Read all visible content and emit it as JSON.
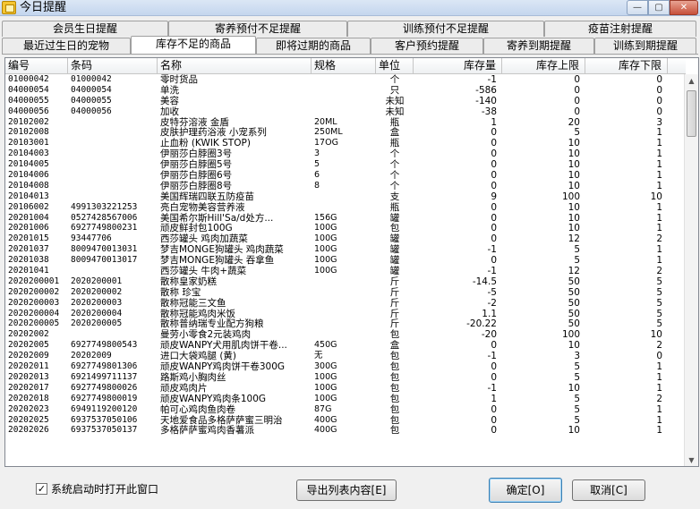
{
  "window": {
    "title": "今日提醒",
    "close_glyph": "✕",
    "min_glyph": "—",
    "max_glyph": "▢"
  },
  "tabs_top": [
    "会员生日提醒",
    "寄养预付不足提醒",
    "训练预付不足提醒",
    "疫苗注射提醒"
  ],
  "tabs_bottom": [
    "最近过生日的宠物",
    "库存不足的商品",
    "即将过期的商品",
    "客户预约提醒",
    "寄养到期提醒",
    "训练到期提醒"
  ],
  "active_tab": "库存不足的商品",
  "columns": [
    "编号",
    "条码",
    "名称",
    "规格",
    "单位",
    "库存量",
    "库存上限",
    "库存下限"
  ],
  "rows": [
    [
      "01000042",
      "01000042",
      "零时货品",
      "",
      "个",
      "-1",
      "0",
      "0"
    ],
    [
      "04000054",
      "04000054",
      "单洗",
      "",
      "只",
      "-586",
      "0",
      "0"
    ],
    [
      "04000055",
      "04000055",
      "美容",
      "",
      "未知",
      "-140",
      "0",
      "0"
    ],
    [
      "04000056",
      "04000056",
      "加收",
      "",
      "未知",
      "-38",
      "0",
      "0"
    ],
    [
      "20102002",
      "",
      "皮特芬溶液 金盾",
      "20ML",
      "瓶",
      "1",
      "20",
      "3"
    ],
    [
      "20102008",
      "",
      "皮肤护理药浴液 小宠系列",
      "250ML",
      "盒",
      "0",
      "5",
      "1"
    ],
    [
      "20103001",
      "",
      "止血粉 (KWIK STOP)",
      "17OG",
      "瓶",
      "0",
      "10",
      "1"
    ],
    [
      "20104003",
      "",
      "伊丽莎白脖圈3号",
      "3",
      "个",
      "0",
      "10",
      "1"
    ],
    [
      "20104005",
      "",
      "伊丽莎白脖圈5号",
      "5",
      "个",
      "0",
      "10",
      "1"
    ],
    [
      "20104006",
      "",
      "伊丽莎白脖圈6号",
      "6",
      "个",
      "0",
      "10",
      "1"
    ],
    [
      "20104008",
      "",
      "伊丽莎白脖圈8号",
      "8",
      "个",
      "0",
      "10",
      "1"
    ],
    [
      "20104013",
      "",
      "美国辉瑞四联五防疫苗",
      "",
      "支",
      "9",
      "100",
      "10"
    ],
    [
      "20106002",
      "4991303221253",
      "亮白宠物美容营养液",
      "",
      "瓶",
      "0",
      "10",
      "1"
    ],
    [
      "20201004",
      "0527428567006",
      "美国希尔斯Hill'Sa/d处方...",
      "156G",
      "罐",
      "0",
      "10",
      "1"
    ],
    [
      "20201006",
      "6927749800231",
      "顽皮鲜封包100G",
      "100G",
      "包",
      "0",
      "10",
      "1"
    ],
    [
      "20201015",
      "93447706",
      "西莎罐头 鸡肉加蔬菜",
      "100G",
      "罐",
      "0",
      "12",
      "2"
    ],
    [
      "20201037",
      "8009470013031",
      "梦吉MONGE狗罐头 鸡肉蔬菜",
      "100G",
      "罐",
      "-1",
      "5",
      "1"
    ],
    [
      "20201038",
      "8009470013017",
      "梦吉MONGE狗罐头 吞拿鱼",
      "100G",
      "罐",
      "0",
      "5",
      "1"
    ],
    [
      "20201041",
      "",
      "西莎罐头 牛肉+蔬菜",
      "100G",
      "罐",
      "-1",
      "12",
      "2"
    ],
    [
      "2020200001",
      "2020200001",
      "散称皇家奶糕",
      "",
      "斤",
      "-14.5",
      "50",
      "5"
    ],
    [
      "2020200002",
      "2020200002",
      "散称 珍宝",
      "",
      "斤",
      "-5",
      "50",
      "5"
    ],
    [
      "2020200003",
      "2020200003",
      "散称冠能三文鱼",
      "",
      "斤",
      "-2",
      "50",
      "5"
    ],
    [
      "2020200004",
      "2020200004",
      "散称冠能鸡肉米饭",
      "",
      "斤",
      "1.1",
      "50",
      "5"
    ],
    [
      "2020200005",
      "2020200005",
      "散称普纳瑞专业配方狗粮",
      "",
      "斤",
      "-20.22",
      "50",
      "5"
    ],
    [
      "20202002",
      "",
      "曼劳小零食2元装鸡肉",
      "",
      "包",
      "-20",
      "100",
      "10"
    ],
    [
      "20202005",
      "6927749800543",
      "顽皮WANPY犬用肌肉饼干卷...",
      "450G",
      "盒",
      "0",
      "10",
      "2"
    ],
    [
      "20202009",
      "20202009",
      "进口大袋鸡腿 (黄)",
      "无",
      "包",
      "-1",
      "3",
      "0"
    ],
    [
      "20202011",
      "6927749801306",
      "顽皮WANPY鸡肉饼干卷300G",
      "300G",
      "包",
      "0",
      "5",
      "1"
    ],
    [
      "20202013",
      "6921499711137",
      "路斯鸡小胸肉丝",
      "100G",
      "包",
      "0",
      "5",
      "1"
    ],
    [
      "20202017",
      "6927749800026",
      "顽皮鸡肉片",
      "100G",
      "包",
      "-1",
      "10",
      "1"
    ],
    [
      "20202018",
      "6927749800019",
      "顽皮WANPY鸡肉条100G",
      "100G",
      "包",
      "1",
      "5",
      "2"
    ],
    [
      "20202023",
      "6949119200120",
      "帕可心鸡肉鱼肉卷",
      "87G",
      "包",
      "0",
      "5",
      "1"
    ],
    [
      "20202025",
      "6937537050106",
      "天地爱食品多格萨萨蜜三明治",
      "400G",
      "包",
      "0",
      "5",
      "1"
    ],
    [
      "20202026",
      "6937537050137",
      "多格萨萨蜜鸡肉香薯派",
      "400G",
      "包",
      "0",
      "10",
      "1"
    ]
  ],
  "footer": {
    "checkbox_label": "系统启动时打开此窗口",
    "checkbox_checked": true,
    "export_label": "导出列表内容[E]",
    "ok_label": "确定[O]",
    "cancel_label": "取消[C]"
  }
}
